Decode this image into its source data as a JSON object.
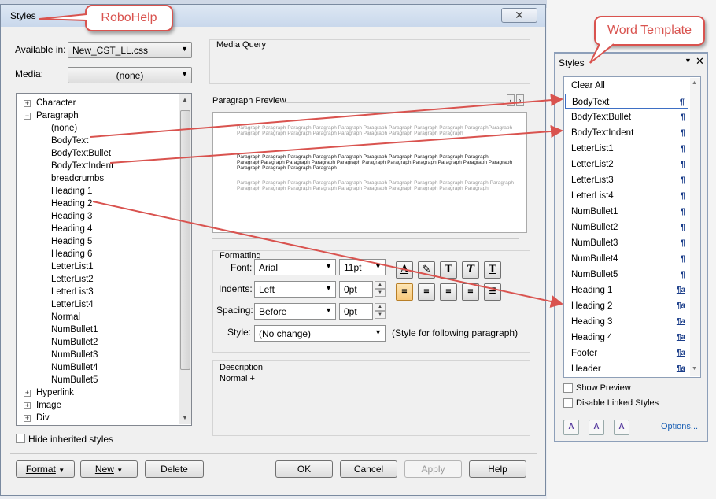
{
  "dialog": {
    "title": "Styles",
    "close_glyph": "✕",
    "available_in_label": "Available in:",
    "available_in_value": "New_CST_LL.css",
    "media_label": "Media:",
    "media_value": "(none)",
    "tree": [
      {
        "label": "Character",
        "level": 0,
        "expander": "+"
      },
      {
        "label": "Paragraph",
        "level": 0,
        "expander": "−"
      },
      {
        "label": "(none)",
        "level": 1
      },
      {
        "label": "BodyText",
        "level": 1
      },
      {
        "label": "BodyTextBullet",
        "level": 1
      },
      {
        "label": "BodyTextIndent",
        "level": 1
      },
      {
        "label": "breadcrumbs",
        "level": 1
      },
      {
        "label": "Heading 1",
        "level": 1
      },
      {
        "label": "Heading 2",
        "level": 1
      },
      {
        "label": "Heading 3",
        "level": 1
      },
      {
        "label": "Heading 4",
        "level": 1
      },
      {
        "label": "Heading 5",
        "level": 1
      },
      {
        "label": "Heading 6",
        "level": 1
      },
      {
        "label": "LetterList1",
        "level": 1
      },
      {
        "label": "LetterList2",
        "level": 1
      },
      {
        "label": "LetterList3",
        "level": 1
      },
      {
        "label": "LetterList4",
        "level": 1
      },
      {
        "label": "Normal",
        "level": 1
      },
      {
        "label": "NumBullet1",
        "level": 1
      },
      {
        "label": "NumBullet2",
        "level": 1
      },
      {
        "label": "NumBullet3",
        "level": 1
      },
      {
        "label": "NumBullet4",
        "level": 1
      },
      {
        "label": "NumBullet5",
        "level": 1
      },
      {
        "label": "Hyperlink",
        "level": 0,
        "expander": "+"
      },
      {
        "label": "Image",
        "level": 0,
        "expander": "+"
      },
      {
        "label": "Div",
        "level": 0,
        "expander": "+"
      }
    ],
    "hide_inherited_label": "Hide inherited styles",
    "media_query_label": "Media Query",
    "paragraph_preview_label": "Paragraph Preview",
    "preview_text_before": "Paragraph Paragraph Paragraph Paragraph Paragraph Paragraph Paragraph Paragraph Paragraph ParagraphParagraph Paragraph Paragraph Paragraph Paragraph Paragraph Paragraph Paragraph Paragraph Paragraph",
    "preview_text_current": "Paragraph Paragraph Paragraph Paragraph Paragraph Paragraph Paragraph Paragraph Paragraph Paragraph ParagraphParagraph Paragraph Paragraph Paragraph Paragraph Paragraph Paragraph Paragraph Paragraph Paragraph Paragraph Paragraph Paragraph Paragraph",
    "preview_text_after": "Paragraph Paragraph Paragraph Paragraph Paragraph Paragraph Paragraph Paragraph Paragraph Paragraph Paragraph Paragraph Paragraph Paragraph Paragraph Paragraph Paragraph Paragraph Paragraph Paragraph Paragraph",
    "formatting": {
      "group_label": "Formatting",
      "font_label": "Font:",
      "font_value": "Arial",
      "size_value": "11pt",
      "indents_label": "Indents:",
      "indents_value": "Left",
      "indent_amount": "0pt",
      "spacing_label": "Spacing:",
      "spacing_value": "Before",
      "spacing_amount": "0pt",
      "style_label": "Style:",
      "style_value": "(No change)",
      "style_note": "(Style for following paragraph)",
      "char_buttons": [
        "A",
        "✎",
        "T",
        "T",
        "T"
      ]
    },
    "description_label": "Description",
    "description_value": "Normal +",
    "buttons": {
      "format": "Format",
      "new": "New",
      "delete": "Delete",
      "ok": "OK",
      "cancel": "Cancel",
      "apply": "Apply",
      "help": "Help"
    }
  },
  "word_panel": {
    "title": "Styles",
    "items": [
      {
        "label": "Clear All",
        "mark": ""
      },
      {
        "label": "BodyText",
        "mark": "¶"
      },
      {
        "label": "BodyTextBullet",
        "mark": "¶"
      },
      {
        "label": "BodyTextIndent",
        "mark": "¶"
      },
      {
        "label": "LetterList1",
        "mark": "¶"
      },
      {
        "label": "LetterList2",
        "mark": "¶"
      },
      {
        "label": "LetterList3",
        "mark": "¶"
      },
      {
        "label": "LetterList4",
        "mark": "¶"
      },
      {
        "label": "NumBullet1",
        "mark": "¶"
      },
      {
        "label": "NumBullet2",
        "mark": "¶"
      },
      {
        "label": "NumBullet3",
        "mark": "¶"
      },
      {
        "label": "NumBullet4",
        "mark": "¶"
      },
      {
        "label": "NumBullet5",
        "mark": "¶"
      },
      {
        "label": "Heading 1",
        "mark": "¶a"
      },
      {
        "label": "Heading 2",
        "mark": "¶a"
      },
      {
        "label": "Heading 3",
        "mark": "¶a"
      },
      {
        "label": "Heading 4",
        "mark": "¶a"
      },
      {
        "label": "Footer",
        "mark": "¶a"
      },
      {
        "label": "Header",
        "mark": "¶a"
      }
    ],
    "selected": "BodyText",
    "show_preview_label": "Show Preview",
    "disable_linked_label": "Disable Linked Styles",
    "options_link": "Options..."
  },
  "callouts": {
    "robohelp": "RoboHelp",
    "word_template": "Word Template"
  },
  "accent_color": "#d9534f"
}
